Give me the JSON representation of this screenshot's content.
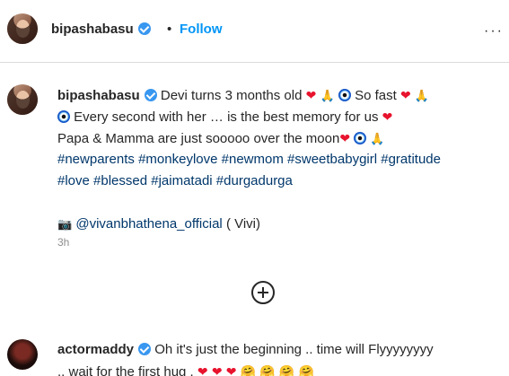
{
  "header": {
    "username": "bipashabasu",
    "separator": "•",
    "follow_label": "Follow",
    "more_label": "···"
  },
  "caption": {
    "username": "bipashabasu",
    "line1_text": "Devi turns 3 months old",
    "line1_tail": "So fast",
    "line2_text": "Every second with her … is the best memory for us",
    "line3_text": "Papa & Mamma are just sooooo over the moon",
    "hashtags_line1": [
      "#newparents",
      "#monkeylove",
      "#newmom",
      "#sweetbabygirl",
      "#gratitude"
    ],
    "hashtags_line2": [
      "#love",
      "#blessed",
      "#jaimatadi",
      "#durgadurga"
    ],
    "credit_handle": "@vivanbhathena_official",
    "credit_suffix": "( Vivi)",
    "time": "3h"
  },
  "load_more": {
    "icon": "plus-circle-icon"
  },
  "comment": {
    "username": "actormaddy",
    "line1_text": "Oh it's just the beginning .. time will Flyyyyyyyy",
    "line2_text": ".. wait for the first hug ."
  },
  "colors": {
    "link_blue": "#0095f6",
    "hashtag": "#00376b",
    "verified": "#3897f0",
    "muted": "#8e8e8e"
  }
}
